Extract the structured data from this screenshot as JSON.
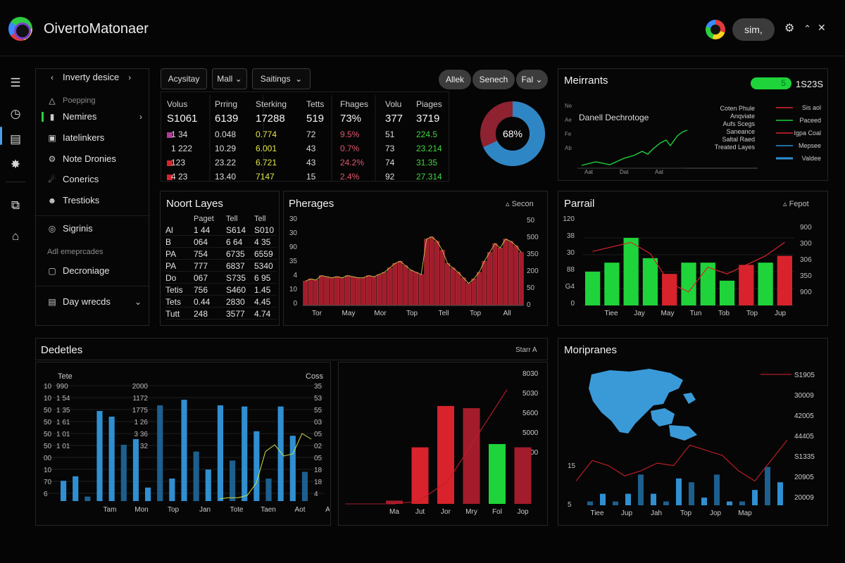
{
  "app": {
    "title": "OivertoMatonaer",
    "user": "sim,"
  },
  "colors": {
    "green": "#1ed43a",
    "red": "#d8232c",
    "darkred": "#a31c2c",
    "blue": "#2f8fd0",
    "lime": "#c8e04a"
  },
  "nav": {
    "header": "Inverty desice",
    "section": "Poepping",
    "items": [
      {
        "label": "Nemires",
        "icon": "bar-chart-icon"
      },
      {
        "label": "Iatelinkers",
        "icon": "image-icon"
      },
      {
        "label": "Note Dronies",
        "icon": "gear-icon"
      },
      {
        "label": "Conerics",
        "icon": "bell-icon"
      },
      {
        "label": "Trestioks",
        "icon": "user-group-icon"
      },
      {
        "label": "Sigrinis",
        "icon": "ring-icon"
      }
    ],
    "section2": "Adl emeprcades",
    "item7": "Decroniage",
    "footer": "Day wrecds"
  },
  "toolbar": {
    "b1": "Acysitay",
    "b2": "Mall",
    "b3": "Saitings",
    "p1": "Allek",
    "p2": "Senech",
    "p3": "Fal"
  },
  "metrics": {
    "headers": [
      "Volus",
      "Prring",
      "Sterking",
      "Tetts",
      "Fhages",
      "Volu",
      "Piages"
    ],
    "row1": [
      "S1061",
      "6139",
      "17288",
      "519",
      "73%",
      "377",
      "3719"
    ],
    "rows": [
      [
        "1 34",
        "0.048",
        "0.774",
        "72",
        "9.5%",
        "51",
        "224.5"
      ],
      [
        "1 222",
        "10.29",
        "6.001",
        "43",
        "0.7%",
        "73",
        "23.214"
      ],
      [
        "123",
        "23.22",
        "6.721",
        "43",
        "24.2%",
        "74",
        "31.35"
      ],
      [
        "4 23",
        "13.40",
        "7147",
        "15",
        "2.4%",
        "92",
        "27.314"
      ]
    ],
    "donut_label": "68%",
    "donut_pct": 0.68
  },
  "merrants": {
    "title": "Meirrants",
    "badge": "5",
    "amount": "1S23S",
    "chart_title": "Danell Dechrotoge",
    "notes": [
      "Coten Phule",
      "Anqviate",
      "Aufs Scegs",
      "Saneance",
      "Saltal Raed",
      "Treated Layes"
    ],
    "legend": [
      "Sis aol",
      "Paceed",
      "Igpa Coal",
      "Mepsee",
      "Valdee"
    ],
    "x_labels": [
      "Aat",
      "Dat",
      "Aat"
    ],
    "ylabels": [
      "Ne",
      "Ae",
      "Fe",
      "Ab"
    ]
  },
  "layers": {
    "title": "Noort Layes",
    "headers": [
      "",
      "Paget",
      "Tell",
      "Tell"
    ],
    "rows": [
      [
        "Al",
        "1 44",
        "S614",
        "S010"
      ],
      [
        "B",
        "064",
        "6 64",
        "4 35"
      ],
      [
        "PA",
        "754",
        "6735",
        "6559"
      ],
      [
        "PA",
        "777",
        "6837",
        "5340"
      ],
      [
        "Do",
        "067",
        "S735",
        "6 95"
      ],
      [
        "Tetis",
        "756",
        "S460",
        "1.45"
      ],
      [
        "Tets",
        "0.44",
        "2830",
        "4.45"
      ],
      [
        "Tutt",
        "248",
        "3577",
        "4.74"
      ]
    ]
  },
  "chart_data": [
    {
      "type": "bar",
      "title": "Pherages",
      "action": "Secon",
      "x_ticks": [
        "Tor",
        "May",
        "Mor",
        "Top",
        "Tell",
        "Top",
        "All"
      ],
      "yleft": [
        "30",
        "30",
        "90",
        "35",
        "4",
        "10",
        "0"
      ],
      "yright": [
        "50",
        "500",
        "350",
        "200",
        "50",
        "0"
      ],
      "values": [
        22,
        24,
        23,
        27,
        26,
        25,
        26,
        25,
        27,
        26,
        25,
        25,
        27,
        26,
        28,
        30,
        34,
        38,
        40,
        36,
        32,
        30,
        28,
        60,
        62,
        58,
        50,
        38,
        34,
        30,
        25,
        20,
        24,
        30,
        40,
        48,
        56,
        52,
        60,
        58,
        54,
        48
      ],
      "ylim": [
        0,
        70
      ]
    },
    {
      "type": "bar",
      "title": "Parrail",
      "action": "Fepot",
      "categories": [
        "Tiee",
        "Jay",
        "May",
        "Tun",
        "Tob",
        "Top",
        "Jup"
      ],
      "values": [
        30,
        38,
        60,
        42,
        28,
        38,
        38,
        22,
        36,
        38,
        44
      ],
      "bar_colors": [
        "green",
        "green",
        "green",
        "green",
        "red",
        "green",
        "green",
        "green",
        "red",
        "green",
        "red"
      ],
      "line": [
        48,
        52,
        56,
        46,
        20,
        12,
        34,
        28,
        36,
        44,
        56
      ],
      "yleft": [
        "120",
        "38",
        "30",
        "88",
        "G4",
        "0"
      ],
      "yright": [
        "900",
        "300",
        "306",
        "350",
        "900"
      ],
      "ylim": [
        0,
        70
      ]
    },
    {
      "type": "bar",
      "title": "Dedetles",
      "action": "Starr A",
      "categories": [
        "Tam",
        "Mon",
        "Top",
        "Jan",
        "Tote",
        "Taen",
        "Aot",
        "Aup"
      ],
      "col_headers": [
        "Tete",
        "Coss"
      ],
      "yleft1": [
        "10",
        "10",
        "50",
        "50",
        "50",
        "50",
        "00",
        "10",
        "70",
        "6"
      ],
      "yleft2": [
        "990",
        "1 54",
        "1 35",
        "1 61",
        "1 01",
        "1 01",
        "",
        "",
        "",
        ""
      ],
      "ymid": [
        "2000",
        "1172",
        "1775",
        "1 26",
        "3 36",
        "1 32",
        "",
        "",
        "",
        ""
      ],
      "yright": [
        "35",
        "53",
        "55",
        "03",
        "05",
        "02",
        "05",
        "18",
        "18",
        "4"
      ],
      "values": [
        18,
        22,
        4,
        80,
        75,
        50,
        55,
        12,
        85,
        20,
        90,
        44,
        28,
        85,
        36,
        84,
        62,
        20,
        84,
        58,
        26
      ],
      "line": [
        2,
        3,
        3,
        5,
        16,
        44,
        50,
        40,
        42,
        60,
        55
      ],
      "ylim": [
        0,
        100
      ]
    },
    {
      "type": "bar",
      "title": "",
      "categories": [
        "Ma",
        "Jut",
        "Jor",
        "Mry",
        "Fol",
        "Jop"
      ],
      "values": [
        3,
        52,
        90,
        88,
        55,
        52
      ],
      "bar_colors": [
        "darkred",
        "red",
        "red",
        "darkred",
        "green",
        "darkred"
      ],
      "line": [
        0,
        2,
        20,
        60,
        100
      ],
      "yright": [
        "8030",
        "5030",
        "5600",
        "5000",
        "5300"
      ],
      "ylim": [
        0,
        110
      ]
    },
    {
      "type": "bar",
      "title": "Moripranes",
      "categories": [
        "Tiee",
        "Jup",
        "Jah",
        "Top",
        "Jop",
        "Map"
      ],
      "values": [
        10,
        30,
        10,
        30,
        80,
        30,
        10,
        70,
        60,
        20,
        80,
        10,
        10,
        40,
        100,
        60
      ],
      "line": [
        20,
        60,
        50,
        30,
        40,
        55,
        50,
        90,
        80,
        70,
        40,
        20,
        60,
        100
      ],
      "yright": [
        "S1905",
        "30009",
        "42005",
        "44405",
        "S1335",
        "20905",
        "20009"
      ],
      "yleft": [
        "15",
        "5"
      ],
      "ylim": [
        0,
        110
      ]
    }
  ]
}
